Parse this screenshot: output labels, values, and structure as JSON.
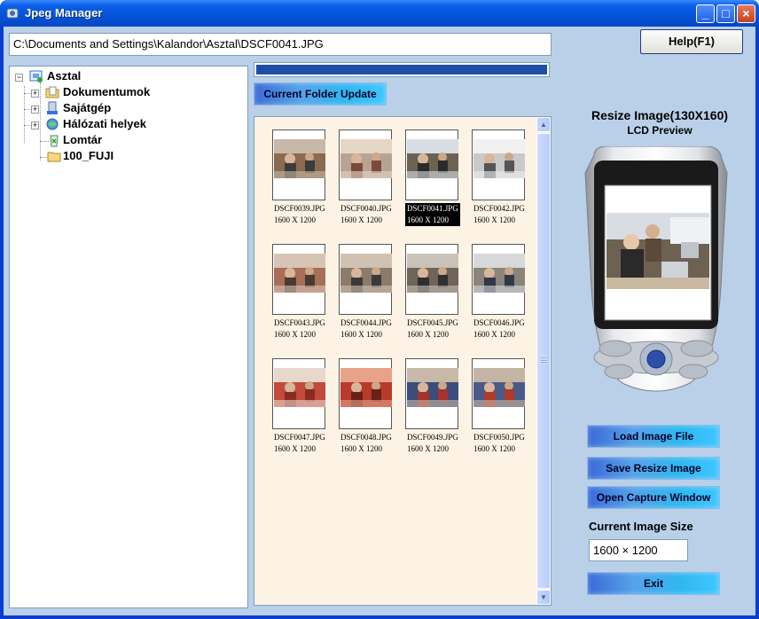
{
  "window": {
    "title": "Jpeg Manager",
    "controls": {
      "minimize": "_",
      "maximize": "□",
      "close": "×"
    }
  },
  "path": "C:\\Documents and Settings\\Kalandor\\Asztal\\DSCF0041.JPG",
  "help_label": "Help(F1)",
  "tree": {
    "root": "Asztal",
    "items": [
      "Dokumentumok",
      "Sajátgép",
      "Hálózati helyek",
      "Lomtár",
      "100_FUJI"
    ]
  },
  "progress": 1.0,
  "folder_update_label": "Current Folder Update",
  "thumbnails": [
    {
      "name": "DSCF0039.JPG",
      "size": "1600 X 1200",
      "selected": false
    },
    {
      "name": "DSCF0040.JPG",
      "size": "1600 X 1200",
      "selected": false
    },
    {
      "name": "DSCF0041.JPG",
      "size": "1600 X 1200",
      "selected": true
    },
    {
      "name": "DSCF0042.JPG",
      "size": "1600 X 1200",
      "selected": false
    },
    {
      "name": "DSCF0043.JPG",
      "size": "1600 X 1200",
      "selected": false
    },
    {
      "name": "DSCF0044.JPG",
      "size": "1600 X 1200",
      "selected": false
    },
    {
      "name": "DSCF0045.JPG",
      "size": "1600 X 1200",
      "selected": false
    },
    {
      "name": "DSCF0046.JPG",
      "size": "1600 X 1200",
      "selected": false
    },
    {
      "name": "DSCF0047.JPG",
      "size": "1600 X 1200",
      "selected": false
    },
    {
      "name": "DSCF0048.JPG",
      "size": "1600 X 1200",
      "selected": false
    },
    {
      "name": "DSCF0049.JPG",
      "size": "1600 X 1200",
      "selected": false
    },
    {
      "name": "DSCF0050.JPG",
      "size": "1600 X 1200",
      "selected": false
    }
  ],
  "preview": {
    "title": "Resize Image(130X160)",
    "subtitle": "LCD Preview"
  },
  "buttons": {
    "load": "Load Image File",
    "save": "Save Resize Image",
    "capture": "Open Capture Window",
    "exit": "Exit"
  },
  "current_size": {
    "label": "Current Image Size",
    "value": "1600 × 1200"
  },
  "colors": {
    "titlebar": "#0553d8",
    "client_bg": "#b9d0e8",
    "gallery_bg": "#fdf3e4",
    "progress": "#1f4fa5"
  }
}
